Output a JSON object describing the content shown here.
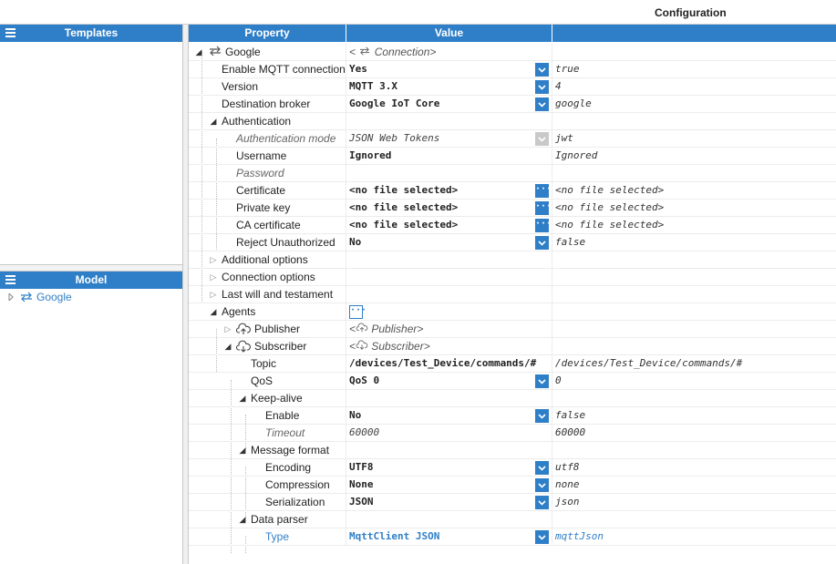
{
  "header": {
    "title": "Configuration"
  },
  "templates_panel": {
    "title": "Templates"
  },
  "model_panel": {
    "title": "Model",
    "items": [
      {
        "label": "Google"
      }
    ]
  },
  "grid": {
    "columns": {
      "property": "Property",
      "value": "Value",
      "raw": ""
    },
    "rows": [
      {
        "label": "Google",
        "value": "",
        "raw": "< Connection>",
        "raw_text": "Connection"
      },
      {
        "label": "Enable MQTT connection",
        "value": "Yes",
        "raw": "true"
      },
      {
        "label": "Version",
        "value": "MQTT 3.X",
        "raw": "4"
      },
      {
        "label": "Destination broker",
        "value": "Google IoT Core",
        "raw": "google"
      },
      {
        "label": "Authentication",
        "value": "",
        "raw": ""
      },
      {
        "label": "Authentication mode",
        "value": "JSON Web Tokens",
        "raw": "jwt"
      },
      {
        "label": "Username",
        "value": "Ignored",
        "raw": "Ignored"
      },
      {
        "label": "Password",
        "value": "",
        "raw": ""
      },
      {
        "label": "Certificate",
        "value": "<no file selected>",
        "raw": "<no file selected>"
      },
      {
        "label": "Private key",
        "value": "<no file selected>",
        "raw": "<no file selected>"
      },
      {
        "label": "CA certificate",
        "value": "<no file selected>",
        "raw": "<no file selected>"
      },
      {
        "label": "Reject Unauthorized",
        "value": "No",
        "raw": "false"
      },
      {
        "label": "Additional options",
        "value": "",
        "raw": ""
      },
      {
        "label": "Connection options",
        "value": "",
        "raw": ""
      },
      {
        "label": "Last will and testament",
        "value": "",
        "raw": ""
      },
      {
        "label": "Agents",
        "value": "",
        "raw": ""
      },
      {
        "label": "Publisher",
        "value": "Publisher",
        "raw": ""
      },
      {
        "label": "Subscriber",
        "value": "Subscriber",
        "raw": ""
      },
      {
        "label": "Topic",
        "value": "/devices/Test_Device/commands/#",
        "raw": "/devices/Test_Device/commands/#"
      },
      {
        "label": "QoS",
        "value": "QoS 0",
        "raw": "0"
      },
      {
        "label": "Keep-alive",
        "value": "",
        "raw": ""
      },
      {
        "label": "Enable",
        "value": "No",
        "raw": "false"
      },
      {
        "label": "Timeout",
        "value": "60000",
        "raw": "60000"
      },
      {
        "label": "Message format",
        "value": "",
        "raw": ""
      },
      {
        "label": "Encoding",
        "value": "UTF8",
        "raw": "utf8"
      },
      {
        "label": "Compression",
        "value": "None",
        "raw": "none"
      },
      {
        "label": "Serialization",
        "value": "JSON",
        "raw": "json"
      },
      {
        "label": "Data parser",
        "value": "",
        "raw": ""
      },
      {
        "label": "Type",
        "value": "MqttClient JSON",
        "raw": "mqttJson"
      }
    ]
  },
  "icons": {
    "menu": "hamburger-menu-icon",
    "dropdown": "chevron-down-icon",
    "ellipsis": "ellipsis-icon",
    "connection": "swap-arrows-icon",
    "publisher": "cloud-upload-icon",
    "subscriber": "cloud-download-icon"
  },
  "colors": {
    "accent": "#2f7fc8",
    "disabled": "#c9c9c9"
  }
}
